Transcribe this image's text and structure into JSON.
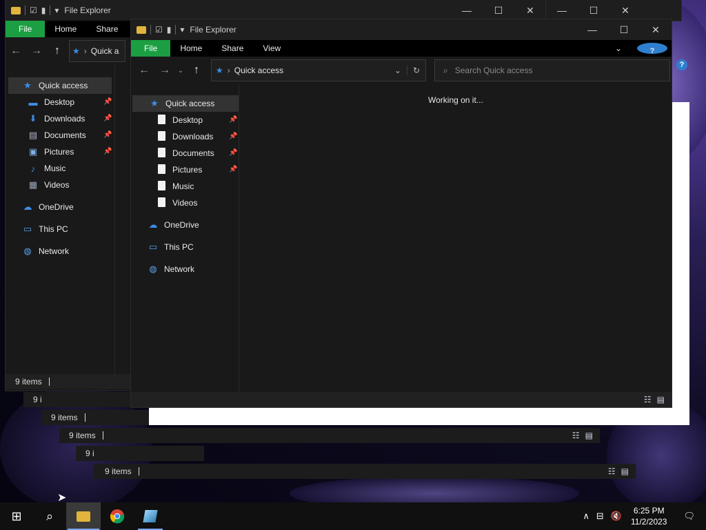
{
  "explorer": {
    "title": "File Explorer",
    "tabs": {
      "file": "File",
      "home": "Home",
      "share": "Share",
      "view": "View"
    },
    "address": {
      "location": "Quick access"
    },
    "search": {
      "placeholder": "Search Quick access"
    },
    "content": {
      "loading_text": "Working on it..."
    },
    "nav": {
      "quick_access": "Quick access",
      "items": [
        "Desktop",
        "Downloads",
        "Documents",
        "Pictures",
        "Music",
        "Videos"
      ],
      "onedrive": "OneDrive",
      "this_pc": "This PC",
      "network": "Network"
    },
    "status": {
      "items_count": "9 items"
    },
    "back_address_partial": "Quick a",
    "stack_partial": "9 i"
  },
  "taskbar": {
    "time": "6:25 PM",
    "date": "11/2/2023"
  },
  "icons": {
    "start": "windows-logo-icon",
    "search": "search-icon",
    "file_explorer": "folder-icon",
    "chrome": "chrome-icon",
    "app": "app-icon"
  },
  "colors": {
    "file_tab": "#1b9f42",
    "accent": "#3d8ee8",
    "background": "#191919"
  }
}
